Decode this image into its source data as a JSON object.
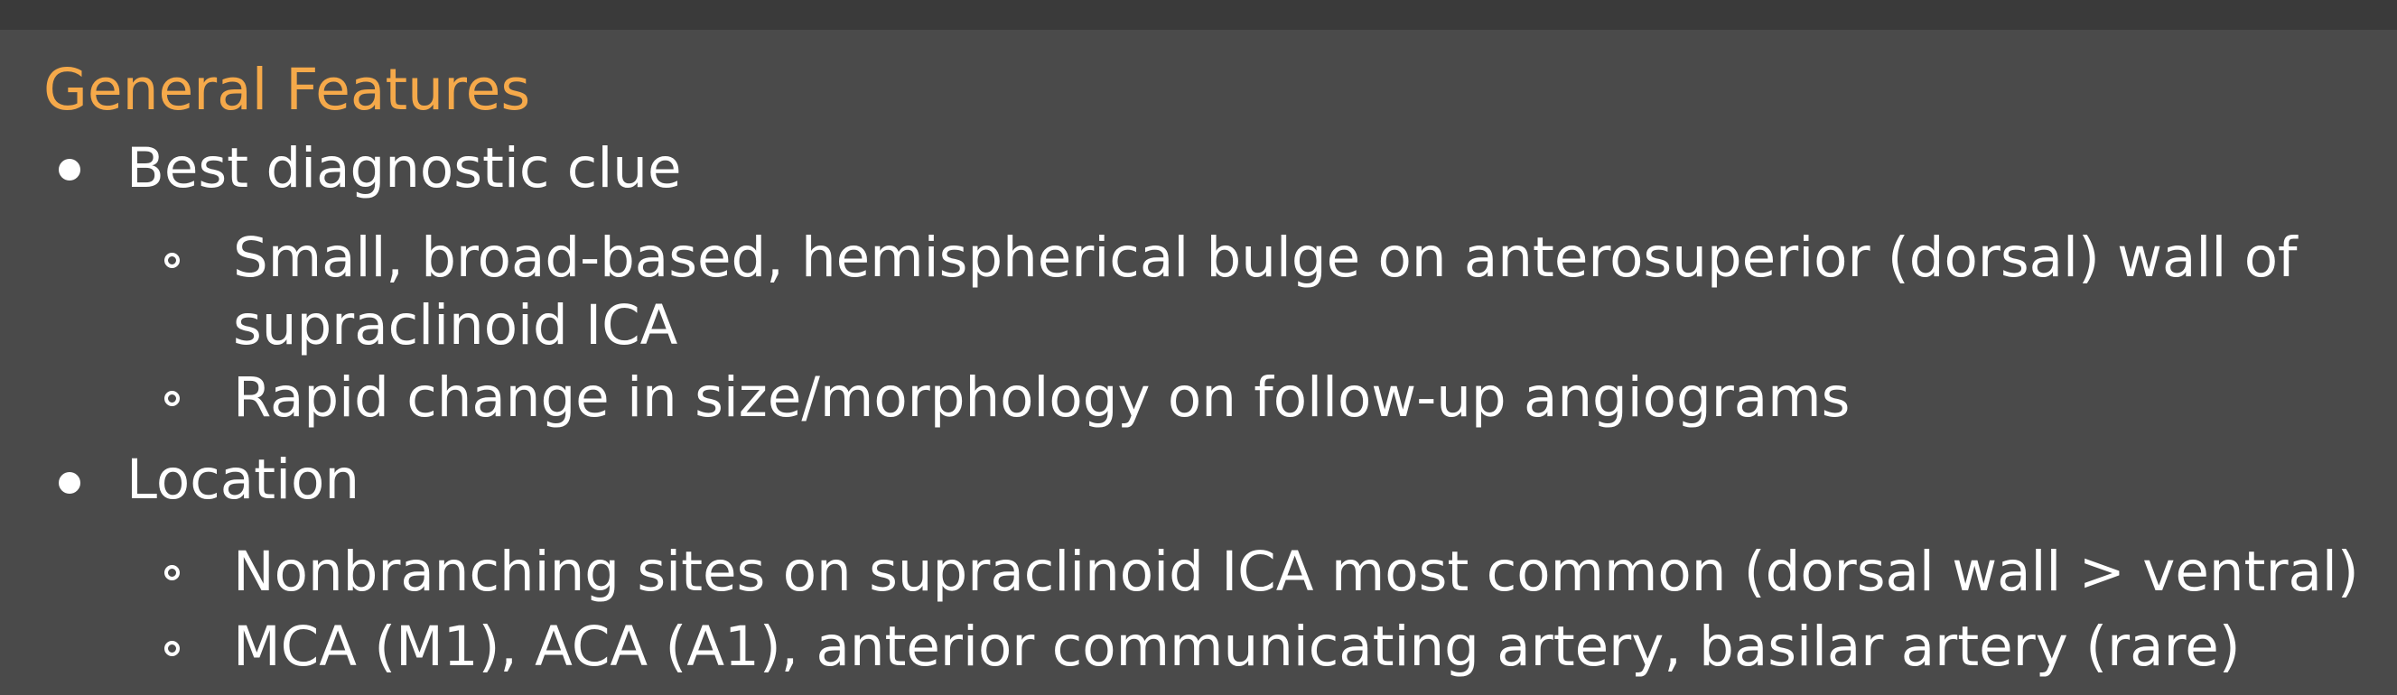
{
  "heading": "General Features",
  "sections": [
    {
      "label": "Best diagnostic clue",
      "items": [
        "Small, broad-based, hemispherical bulge on anterosuperior (dorsal) wall of",
        "supraclinoid ICA",
        "Rapid change in size/morphology on follow-up angiograms"
      ]
    },
    {
      "label": "Location",
      "items": [
        "Nonbranching sites on supraclinoid ICA most common (dorsal wall > ventral)",
        "MCA (M1), ACA (A1), anterior communicating artery, basilar artery (rare)"
      ]
    }
  ],
  "colors": {
    "background": "#4a4a4a",
    "top_strip": "#3a3a3a",
    "heading": "#f5a94a",
    "text": "#ffffff"
  }
}
